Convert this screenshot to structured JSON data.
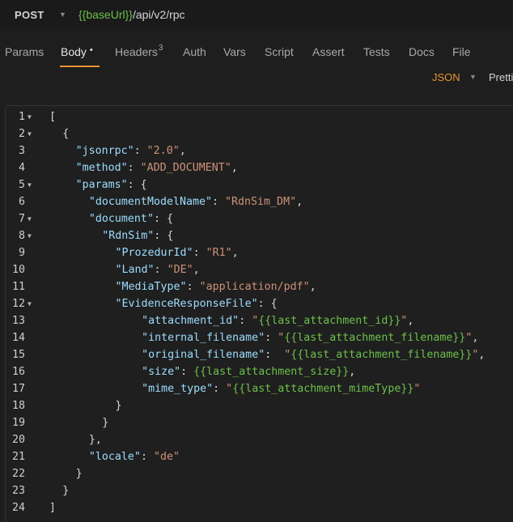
{
  "request": {
    "method": "POST",
    "url_var": "{{baseUrl}}",
    "url_path": "/api/v2/rpc"
  },
  "tabs": [
    {
      "label": "Params"
    },
    {
      "label": "Body",
      "modified_marker": "•"
    },
    {
      "label": "Headers",
      "count": "3"
    },
    {
      "label": "Auth"
    },
    {
      "label": "Vars"
    },
    {
      "label": "Script"
    },
    {
      "label": "Assert"
    },
    {
      "label": "Tests"
    },
    {
      "label": "Docs"
    },
    {
      "label": "File"
    }
  ],
  "active_tab": "Body",
  "body_mode": {
    "selected": "JSON",
    "prettify_label": "Prettify"
  },
  "editor": {
    "lines": [
      {
        "n": "1",
        "fold": true,
        "indent": 0,
        "tokens": [
          [
            "punc",
            "["
          ]
        ]
      },
      {
        "n": "2",
        "fold": true,
        "indent": 1,
        "tokens": [
          [
            "punc",
            "{"
          ]
        ]
      },
      {
        "n": "3",
        "fold": false,
        "indent": 2,
        "tokens": [
          [
            "key",
            "\"jsonrpc\""
          ],
          [
            "punc",
            ": "
          ],
          [
            "str",
            "\"2.0\""
          ],
          [
            "punc",
            ","
          ]
        ]
      },
      {
        "n": "4",
        "fold": false,
        "indent": 2,
        "tokens": [
          [
            "key",
            "\"method\""
          ],
          [
            "punc",
            ": "
          ],
          [
            "str",
            "\"ADD_DOCUMENT\""
          ],
          [
            "punc",
            ","
          ]
        ]
      },
      {
        "n": "5",
        "fold": true,
        "indent": 2,
        "tokens": [
          [
            "key",
            "\"params\""
          ],
          [
            "punc",
            ": {"
          ]
        ]
      },
      {
        "n": "6",
        "fold": false,
        "indent": 3,
        "tokens": [
          [
            "key",
            "\"documentModelName\""
          ],
          [
            "punc",
            ": "
          ],
          [
            "str",
            "\"RdnSim_DM\""
          ],
          [
            "punc",
            ","
          ]
        ]
      },
      {
        "n": "7",
        "fold": true,
        "indent": 3,
        "tokens": [
          [
            "key",
            "\"document\""
          ],
          [
            "punc",
            ": {"
          ]
        ]
      },
      {
        "n": "8",
        "fold": true,
        "indent": 4,
        "tokens": [
          [
            "key",
            "\"RdnSim\""
          ],
          [
            "punc",
            ": {"
          ]
        ]
      },
      {
        "n": "9",
        "fold": false,
        "indent": 5,
        "tokens": [
          [
            "key",
            "\"ProzedurId\""
          ],
          [
            "punc",
            ": "
          ],
          [
            "str",
            "\"R1\""
          ],
          [
            "punc",
            ","
          ]
        ]
      },
      {
        "n": "10",
        "fold": false,
        "indent": 5,
        "tokens": [
          [
            "key",
            "\"Land\""
          ],
          [
            "punc",
            ": "
          ],
          [
            "str",
            "\"DE\""
          ],
          [
            "punc",
            ","
          ]
        ]
      },
      {
        "n": "11",
        "fold": false,
        "indent": 5,
        "tokens": [
          [
            "key",
            "\"MediaType\""
          ],
          [
            "punc",
            ": "
          ],
          [
            "str",
            "\"application/pdf\""
          ],
          [
            "punc",
            ","
          ]
        ]
      },
      {
        "n": "12",
        "fold": true,
        "indent": 5,
        "tokens": [
          [
            "key",
            "\"EvidenceResponseFile\""
          ],
          [
            "punc",
            ": {"
          ]
        ]
      },
      {
        "n": "13",
        "fold": false,
        "indent": 7,
        "tokens": [
          [
            "key",
            "\"attachment_id\""
          ],
          [
            "punc",
            ": "
          ],
          [
            "quote",
            "\""
          ],
          [
            "var",
            "{{last_attachment_id}}"
          ],
          [
            "quote",
            "\""
          ],
          [
            "punc",
            ","
          ]
        ]
      },
      {
        "n": "14",
        "fold": false,
        "indent": 7,
        "tokens": [
          [
            "key",
            "\"internal_filename\""
          ],
          [
            "punc",
            ": "
          ],
          [
            "quote",
            "\""
          ],
          [
            "var",
            "{{last_attachment_filename}}"
          ],
          [
            "quote",
            "\""
          ],
          [
            "punc",
            ","
          ]
        ]
      },
      {
        "n": "15",
        "fold": false,
        "indent": 7,
        "tokens": [
          [
            "key",
            "\"original_filename\""
          ],
          [
            "punc",
            ":  "
          ],
          [
            "quote",
            "\""
          ],
          [
            "var",
            "{{last_attachment_filename}}"
          ],
          [
            "quote",
            "\""
          ],
          [
            "punc",
            ","
          ]
        ]
      },
      {
        "n": "16",
        "fold": false,
        "indent": 7,
        "tokens": [
          [
            "key",
            "\"size\""
          ],
          [
            "punc",
            ": "
          ],
          [
            "var",
            "{{last_attachment_size}}"
          ],
          [
            "punc",
            ","
          ]
        ]
      },
      {
        "n": "17",
        "fold": false,
        "indent": 7,
        "tokens": [
          [
            "key",
            "\"mime_type\""
          ],
          [
            "punc",
            ": "
          ],
          [
            "quote",
            "\""
          ],
          [
            "var",
            "{{last_attachment_mimeType}}"
          ],
          [
            "quote",
            "\""
          ]
        ]
      },
      {
        "n": "18",
        "fold": false,
        "indent": 5,
        "tokens": [
          [
            "punc",
            "}"
          ]
        ]
      },
      {
        "n": "19",
        "fold": false,
        "indent": 4,
        "tokens": [
          [
            "punc",
            "}"
          ]
        ]
      },
      {
        "n": "20",
        "fold": false,
        "indent": 3,
        "tokens": [
          [
            "punc",
            "},"
          ]
        ]
      },
      {
        "n": "21",
        "fold": false,
        "indent": 3,
        "tokens": [
          [
            "key",
            "\"locale\""
          ],
          [
            "punc",
            ": "
          ],
          [
            "str",
            "\"de\""
          ]
        ]
      },
      {
        "n": "22",
        "fold": false,
        "indent": 2,
        "tokens": [
          [
            "punc",
            "}"
          ]
        ]
      },
      {
        "n": "23",
        "fold": false,
        "indent": 1,
        "tokens": [
          [
            "punc",
            "}"
          ]
        ]
      },
      {
        "n": "24",
        "fold": false,
        "indent": 0,
        "tokens": [
          [
            "punc",
            "]"
          ]
        ]
      }
    ]
  },
  "colors": {
    "accent": "#e8942e",
    "variable": "#6cc04a",
    "key": "#9cdcfe",
    "string": "#ce9178",
    "background": "#1e1e1e"
  },
  "icons": {
    "method_caret": "chevron-down-icon",
    "mode_caret": "chevron-down-icon",
    "fold_marker": "fold-caret-icon"
  }
}
